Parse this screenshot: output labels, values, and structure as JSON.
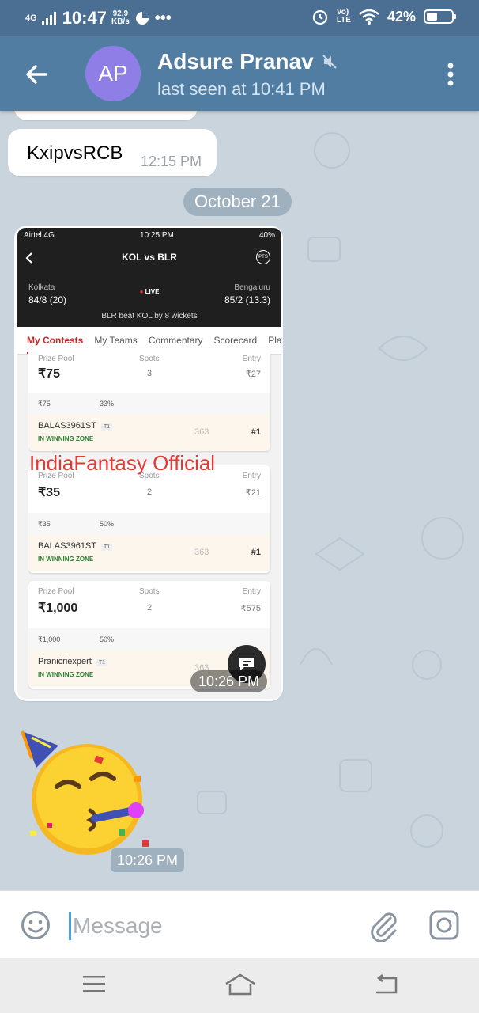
{
  "status_bar": {
    "network": "4G",
    "time": "10:47",
    "speed_value": "92.9",
    "speed_unit": "KB/s",
    "battery": "42%",
    "battery_level": 0.42
  },
  "header": {
    "avatar_initials": "AP",
    "contact_name": "Adsure Pranav",
    "last_seen": "last seen at 10:41 PM"
  },
  "messages": {
    "text_message": {
      "text": "KxipvsRCB",
      "time": "12:15 PM"
    },
    "date_separator": "October 21",
    "image_message": {
      "time": "10:26 PM",
      "overlay_text": "IndiaFantasy Official"
    },
    "sticker_message": {
      "time": "10:26 PM"
    }
  },
  "screenshot": {
    "status_carrier": "Airtel 4G",
    "status_time": "10:25 PM",
    "status_battery": "40%",
    "title": "KOL vs BLR",
    "pts_label": "PTS",
    "team_left": "Kolkata",
    "score_left": "84/8 (20)",
    "team_right": "Bengaluru",
    "score_right": "85/2 (13.3)",
    "live": "LIVE",
    "result": "BLR beat KOL by 8 wickets",
    "tabs": [
      "My Contests",
      "My Teams",
      "Commentary",
      "Scorecard",
      "Play"
    ],
    "prize_pool_label": "Prize Pool",
    "spots_label": "Spots",
    "entry_label": "Entry",
    "contests": [
      {
        "prize": "₹75",
        "spots": "3",
        "entry": "₹27",
        "first": "₹75",
        "win_pct": "33%",
        "user": "BALAS3961ST",
        "team": "T1",
        "zone": "IN WINNING ZONE",
        "points": "363",
        "rank": "#1"
      },
      {
        "prize": "₹35",
        "spots": "2",
        "entry": "₹21",
        "first": "₹35",
        "win_pct": "50%",
        "user": "BALAS3961ST",
        "team": "T1",
        "zone": "IN WINNING ZONE",
        "points": "363",
        "rank": "#1"
      },
      {
        "prize": "₹1,000",
        "spots": "2",
        "entry": "₹575",
        "first": "₹1,000",
        "win_pct": "50%",
        "user": "Pranicriexpert",
        "team": "T1",
        "zone": "IN WINNING ZONE",
        "points": "363",
        "rank": ""
      }
    ]
  },
  "input": {
    "placeholder": "Message"
  },
  "colors": {
    "header": "#517da2",
    "status": "#4b6f93",
    "avatar": "#8e7ee6",
    "chat_bg": "#c9d4dd",
    "accent": "#4aa0e6"
  }
}
